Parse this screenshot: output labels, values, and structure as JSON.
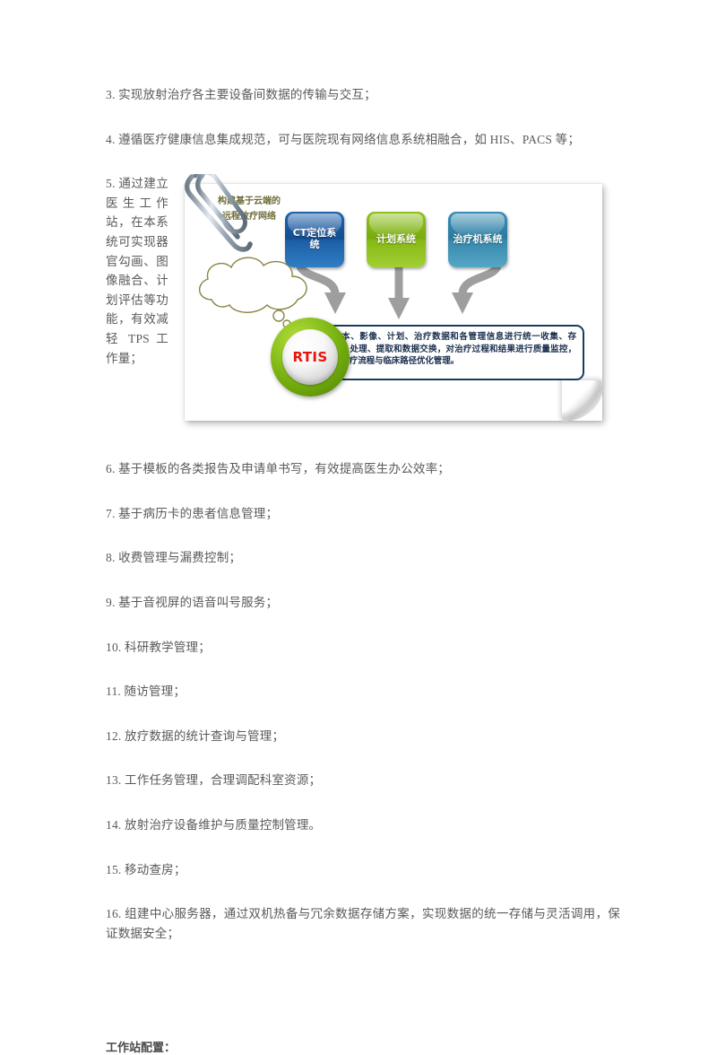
{
  "document": {
    "paragraphs_before": [
      "3. 实现放射治疗各主要设备间数据的传输与交互；",
      "4. 遵循医疗健康信息集成规范，可与医院现有网络信息系统相融合，如 HIS、PACS 等；"
    ],
    "wrapped_paragraph": "5. 通过建立医生工作站，在本系统可实现器官勾画、图像融合、计划评估等功能，有效减轻 TPS 工作量；",
    "paragraphs_after": [
      "6. 基于模板的各类报告及申请单书写，有效提高医生办公效率；",
      "7. 基于病历卡的患者信息管理；",
      "8. 收费管理与漏费控制；",
      "9. 基于音视屏的语音叫号服务；",
      "10. 科研教学管理；",
      "11. 随访管理；",
      "12. 放疗数据的统计查询与管理；",
      "13. 工作任务管理，合理调配科室资源；",
      "14. 放射治疗设备维护与质量控制管理。",
      "15. 移动查房；",
      "16. 组建中心服务器，通过双机热备与冗余数据存储方案，实现数据的统一存储与灵活调用，保证数据安全；"
    ],
    "section_heading": "工作站配置："
  },
  "figure": {
    "system_boxes": [
      {
        "label": "CT定位系统",
        "color": "#144e92"
      },
      {
        "label": "计划系统",
        "color": "#79ab10"
      },
      {
        "label": "治疗机系统",
        "color": "#2b7b9f"
      }
    ],
    "cloud_text_line1": "构建基于云端的",
    "cloud_text_line2": "远程放疗网络",
    "core_label": "RTIS",
    "core_label_color": "#e8140c",
    "core_ring_color": "#7fb61a",
    "description": "文本、影像、计划、治疗数据和各管理信息进行统一收集、存储、处理、提取和数据交换，对治疗过程和结果进行质量监控，对治疗流程与临床路径优化管理。",
    "description_border_color": "#1b3a63",
    "arrow_color": "#9e9e9e"
  }
}
